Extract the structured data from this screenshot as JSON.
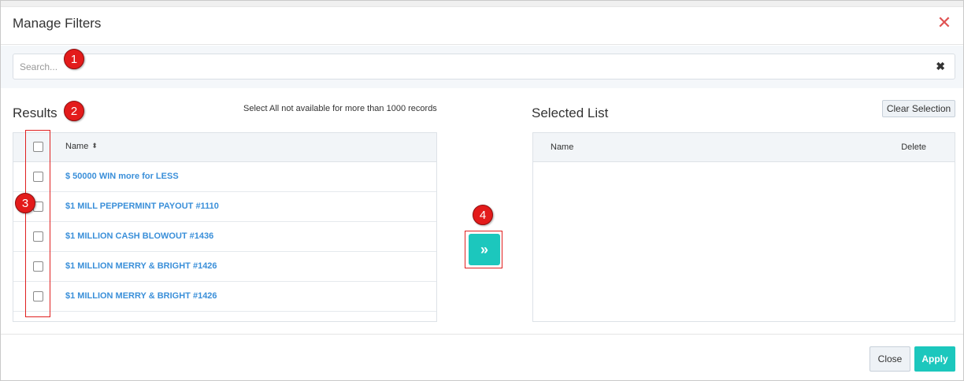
{
  "modal": {
    "title": "Manage Filters",
    "close_icon": "close-icon",
    "accent_color": "#1cc7bd"
  },
  "search": {
    "placeholder": "Search...",
    "value": ""
  },
  "results": {
    "title": "Results",
    "note": "Select All not available for more than 1000 records",
    "column_name": "Name",
    "rows": [
      {
        "label": "$ 50000 WIN more for LESS",
        "checked": false
      },
      {
        "label": "$1 MILL PEPPERMINT PAYOUT #1110",
        "checked": false
      },
      {
        "label": "$1 MILLION CASH BLOWOUT #1436",
        "checked": false
      },
      {
        "label": "$1 MILLION MERRY & BRIGHT #1426",
        "checked": false
      },
      {
        "label": "$1 MILLION MERRY & BRIGHT #1426",
        "checked": false
      }
    ]
  },
  "move_button": {
    "glyph": "»"
  },
  "selected": {
    "title": "Selected List",
    "clear_label": "Clear Selection",
    "column_name": "Name",
    "column_delete": "Delete"
  },
  "footer": {
    "close_label": "Close",
    "apply_label": "Apply"
  },
  "annotations": [
    "1",
    "2",
    "3",
    "4"
  ]
}
